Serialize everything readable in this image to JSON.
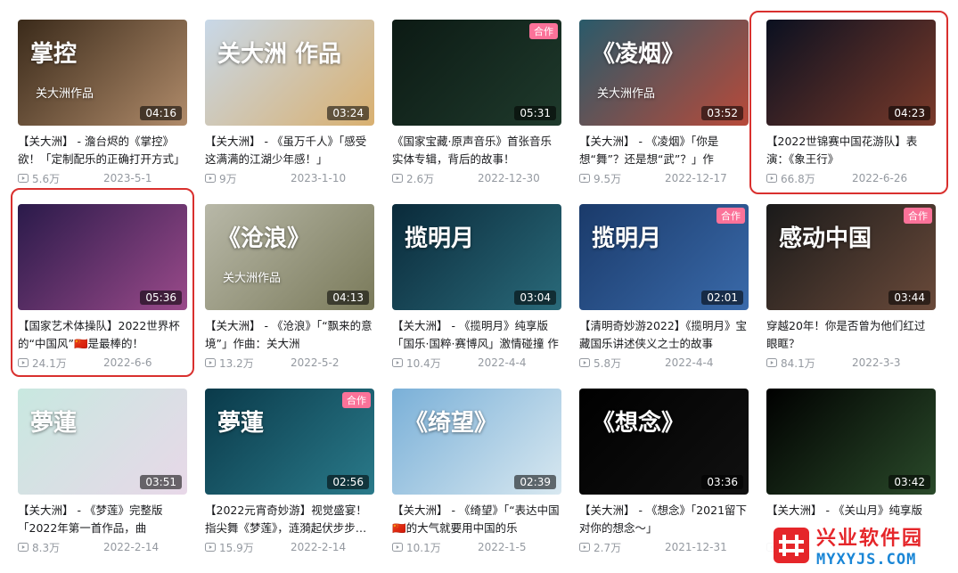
{
  "videos": [
    {
      "title": "【关大洲】 - 澹台烬的《掌控》欲！「定制配乐的正确打开方式」",
      "views": "5.6万",
      "date": "2023-5-1",
      "duration": "04:16",
      "art_text": "掌控",
      "art_sub": "关大洲作品",
      "colors": [
        "#3a2a1a",
        "#b08b6a"
      ]
    },
    {
      "title": "【关大洲】 - 《虽万千人》「感受这满满的江湖少年感！」",
      "views": "9万",
      "date": "2023-1-10",
      "duration": "03:24",
      "art_text": "关大洲 作品",
      "colors": [
        "#c8d8e8",
        "#d9b070"
      ]
    },
    {
      "title": "《国家宝藏·原声音乐》首张音乐实体专辑，背后的故事！",
      "views": "2.6万",
      "date": "2022-12-30",
      "duration": "05:31",
      "badge": "合作",
      "colors": [
        "#0c1a14",
        "#1f3a2c"
      ]
    },
    {
      "title": "【关大洲】 - 《凌烟》「你是想“舞”？还是想“武”？」作",
      "views": "9.5万",
      "date": "2022-12-17",
      "duration": "03:52",
      "art_text": "《凌烟》",
      "art_sub": "关大洲作品",
      "colors": [
        "#2a5a6a",
        "#b84a3a"
      ]
    },
    {
      "title": "【2022世锦赛中国花游队】表演：《象王行》",
      "views": "66.8万",
      "date": "2022-6-26",
      "duration": "04:23",
      "colors": [
        "#0a1020",
        "#7a3a2a"
      ]
    },
    {
      "title": "【国家艺术体操队】2022世界杯的“中国风”🇨🇳是最棒的！",
      "views": "24.1万",
      "date": "2022-6-6",
      "duration": "05:36",
      "colors": [
        "#2a1a4a",
        "#9a4a8a"
      ]
    },
    {
      "title": "【关大洲】 - 《沧浪》「“飘来的意境”」作曲：关大洲",
      "views": "13.2万",
      "date": "2022-5-2",
      "duration": "04:13",
      "art_text": "《沧浪》",
      "art_sub": "关大洲作品",
      "colors": [
        "#b8b8a8",
        "#7a7a5a"
      ]
    },
    {
      "title": "【关大洲】 - 《揽明月》纯享版「国乐·国粹·赛博风」激情碰撞 作",
      "views": "10.4万",
      "date": "2022-4-4",
      "duration": "03:04",
      "art_text": "揽明月",
      "colors": [
        "#0a2a3a",
        "#2a6a7a"
      ]
    },
    {
      "title": "【清明奇妙游2022】《揽明月》宝藏国乐讲述侠义之士的故事",
      "views": "5.8万",
      "date": "2022-4-4",
      "duration": "02:01",
      "badge": "合作",
      "art_text": "揽明月",
      "colors": [
        "#1a3a6a",
        "#3a6aaa"
      ]
    },
    {
      "title": "穿越20年！你是否曾为他们红过眼眶？",
      "views": "84.1万",
      "date": "2022-3-3",
      "duration": "03:44",
      "badge": "合作",
      "art_text": "感动中国",
      "colors": [
        "#1a1a1a",
        "#6a4a3a"
      ]
    },
    {
      "title": "【关大洲】 - 《梦莲》完整版「2022年第一首作品，曲",
      "views": "8.3万",
      "date": "2022-2-14",
      "duration": "03:51",
      "art_text": "夢蓮",
      "colors": [
        "#c8e8e0",
        "#e8d8e8"
      ]
    },
    {
      "title": "【2022元宵奇妙游】视觉盛宴！指尖舞《梦莲》，涟漪起伏步步生莲",
      "views": "15.9万",
      "date": "2022-2-14",
      "duration": "02:56",
      "badge": "合作",
      "art_text": "夢蓮",
      "colors": [
        "#0a3a4a",
        "#2a7a8a"
      ]
    },
    {
      "title": "【关大洲】 - 《绮望》「“表达中国🇨🇳的大气就要用中国的乐",
      "views": "10.1万",
      "date": "2022-1-5",
      "duration": "02:39",
      "art_text": "《绮望》",
      "colors": [
        "#7ab0d8",
        "#d8e8f0"
      ]
    },
    {
      "title": "【关大洲】 - 《想念》「2021留下对你的想念～」",
      "views": "2.7万",
      "date": "2021-12-31",
      "duration": "03:36",
      "art_text": "《想念》",
      "colors": [
        "#000000",
        "#111111"
      ]
    },
    {
      "title": "【关大洲】 - 《关山月》纯享版",
      "views": "",
      "date": "",
      "duration": "03:42",
      "colors": [
        "#000000",
        "#2a4a2a"
      ]
    }
  ],
  "watermark": {
    "cn": "兴业软件园",
    "en": "MYXYJS.COM"
  }
}
